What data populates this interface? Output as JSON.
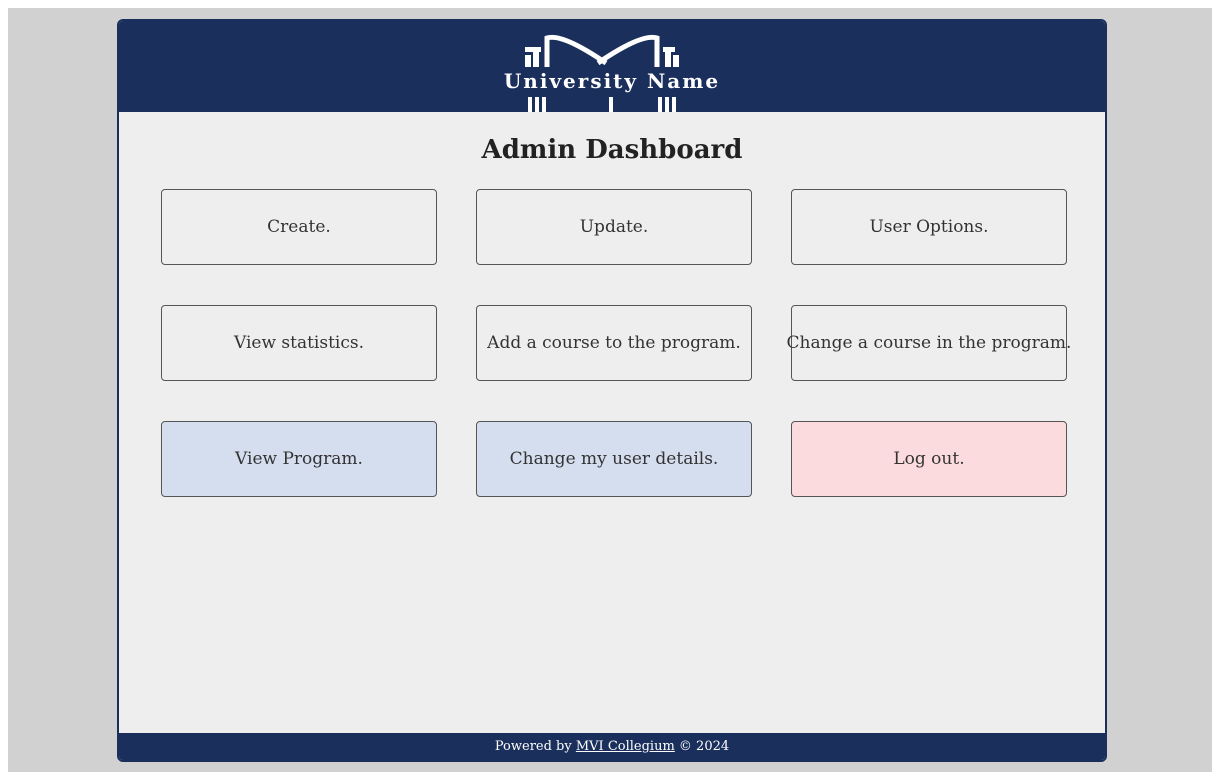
{
  "header": {
    "university_name": "University Name",
    "brand_color": "#1b2f5c"
  },
  "main": {
    "title": "Admin Dashboard",
    "tiles": [
      {
        "label": "Create.",
        "variant": "default"
      },
      {
        "label": "Update.",
        "variant": "default"
      },
      {
        "label": "User Options.",
        "variant": "default"
      },
      {
        "label": "View statistics.",
        "variant": "default"
      },
      {
        "label": "Add a course to the program.",
        "variant": "default"
      },
      {
        "label": "Change a course in the program.",
        "variant": "default"
      },
      {
        "label": "View Program.",
        "variant": "blue"
      },
      {
        "label": "Change my user details.",
        "variant": "blue"
      },
      {
        "label": "Log out.",
        "variant": "red"
      }
    ],
    "colors": {
      "default_tile": "#eeeeee",
      "blue_tile": "#d4deef",
      "red_tile": "#fcdbdf"
    }
  },
  "footer": {
    "prefix": "Powered by ",
    "link_text": "MVI Collegium",
    "suffix": " © 2024"
  }
}
